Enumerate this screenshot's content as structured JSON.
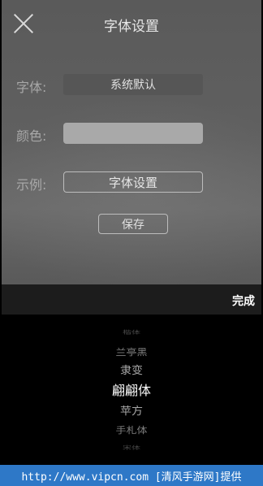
{
  "header": {
    "title": "字体设置"
  },
  "form": {
    "font_label": "字体:",
    "font_value": "系统默认",
    "color_label": "颜色:",
    "color_value": "#a9a9a9",
    "sample_label": "示例:",
    "sample_text": "字体设置"
  },
  "actions": {
    "save_label": "保存",
    "done_label": "完成"
  },
  "picker": {
    "items": [
      "楷体",
      "兰亭黑",
      "隶变",
      "翩翩体",
      "苹方",
      "手札体",
      "宋体"
    ],
    "selected_index": 3
  },
  "footer": {
    "text": "http://www.vipcn.com [清风手游网]提供"
  }
}
